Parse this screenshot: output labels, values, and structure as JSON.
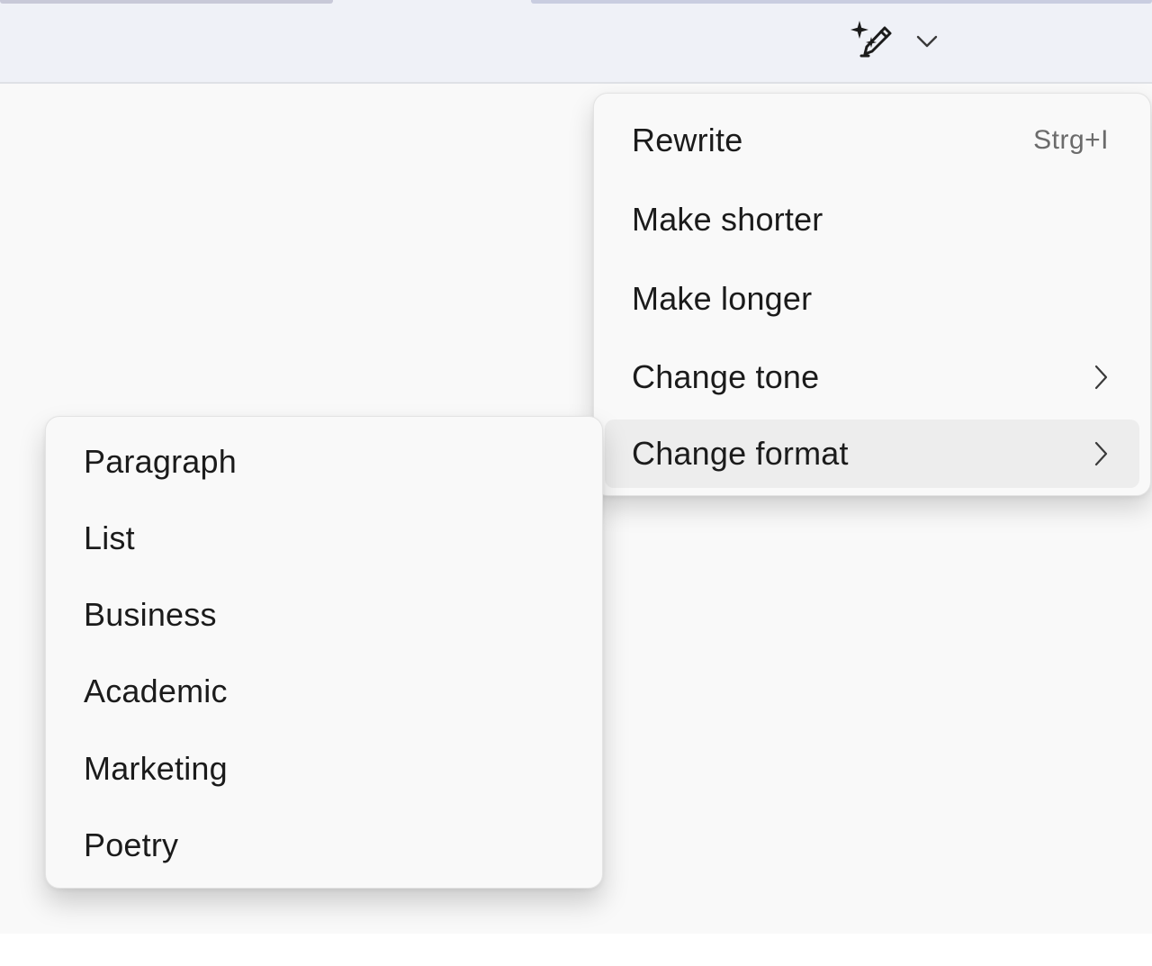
{
  "toolbar": {
    "copilot_icon": "sparkle-pen-icon",
    "dropdown_icon": "chevron-down-icon"
  },
  "menu": {
    "items": [
      {
        "label": "Rewrite",
        "shortcut": "Strg+I"
      },
      {
        "label": "Make shorter"
      },
      {
        "label": "Make longer"
      },
      {
        "label": "Change tone",
        "icon": "chevron-right-icon"
      },
      {
        "label": "Change format",
        "icon": "chevron-right-icon",
        "highlighted": true
      }
    ]
  },
  "submenu": {
    "items": [
      {
        "label": "Paragraph"
      },
      {
        "label": "List"
      },
      {
        "label": "Business"
      },
      {
        "label": "Academic"
      },
      {
        "label": "Marketing"
      },
      {
        "label": "Poetry"
      }
    ]
  }
}
